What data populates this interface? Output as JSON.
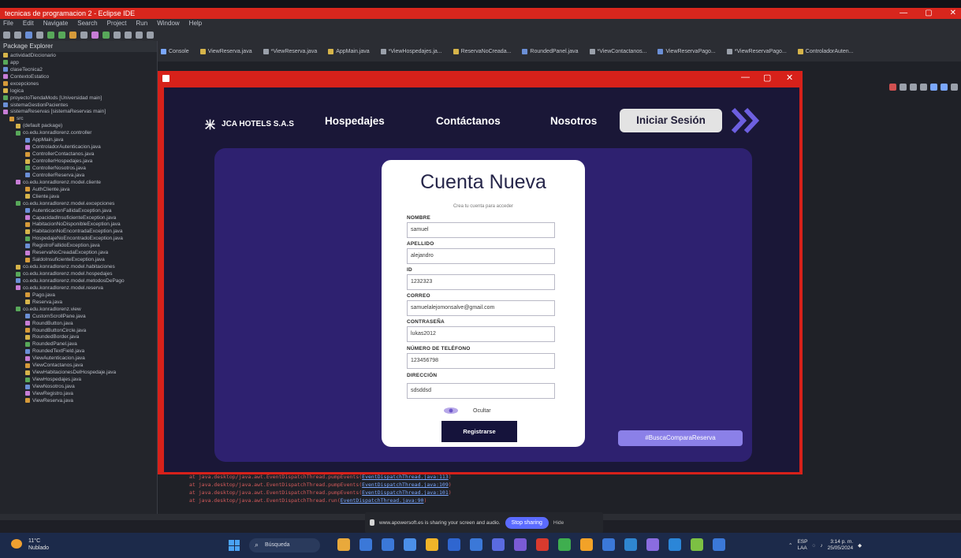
{
  "eclipse": {
    "title": "tecnicas de programacion 2 - Eclipse IDE",
    "window_controls": [
      "—",
      "▢",
      "✕"
    ],
    "menu": [
      "File",
      "Edit",
      "Navigate",
      "Search",
      "Project",
      "Run",
      "Window",
      "Help"
    ],
    "package_explorer_title": "Package Explorer",
    "tree": [
      "actividadDiccionario",
      "app",
      "claseTecnica2",
      "ContextoEstatico",
      "excepciones",
      "logica",
      "proyectoTiendaMods [Universidad main]",
      "sistemaGestionPacientes",
      "sistemaReservas [sistemaReservas main]",
      "src",
      "(default package)",
      "co.edu.konradlorenz.controller",
      "AppMain.java",
      "ControladorAutenticacion.java",
      "ControllerContactanos.java",
      "ControllerHospedajes.java",
      "ControllerNosotros.java",
      "ControllerReserva.java",
      "co.edu.konradlorenz.model.cliente",
      "AuthCliente.java",
      "Cliente.java",
      "co.edu.konradlorenz.model.excepciones",
      "AutenticacionFallidaException.java",
      "CapacidadInsuficienteException.java",
      "HabitacionNoDisponibleException.java",
      "HabitacionNoEncontradaException.java",
      "HospedajeNoEncontradoException.java",
      "RegistroFallidoException.java",
      "ReservaNoCreadaException.java",
      "SaldoInsuficienteException.java",
      "co.edu.konradlorenz.model.habitaciones",
      "co.edu.konradlorenz.model.hospedajes",
      "co.edu.konradlorenz.model.metodosDePago",
      "co.edu.konradlorenz.model.reserva",
      "Pago.java",
      "Reserva.java",
      "co.edu.konradlorenz.view",
      "CustomScrollPane.java",
      "RoundButton.java",
      "RoundButtonCircle.java",
      "RoundedBorder.java",
      "RoundedPanel.java",
      "RoundedTextField.java",
      "ViewAutenticacion.java",
      "ViewContactanos.java",
      "ViewHabitacionesDelHospedaje.java",
      "ViewHospedajes.java",
      "ViewNosotros.java",
      "ViewRegistro.java",
      "ViewReserva.java"
    ],
    "tabs": [
      "Console",
      "ViewReserva.java",
      "*ViewReserva.java",
      "AppMain.java",
      "*ViewHospedajes.ja...",
      "ReservaNoCreada...",
      "RoundedPanel.java",
      "*ViewContactanos...",
      "ViewReservaPago...",
      "*ViewReservaPago...",
      "ControladorAuten..."
    ],
    "console": [
      {
        "text": "at java.desktop/java.awt.EventDispatchThread.pumpEvents(",
        "link": "EventDispatchThread.java:113",
        "end": ")"
      },
      {
        "text": "at java.desktop/java.awt.EventDispatchThread.pumpEvents(",
        "link": "EventDispatchThread.java:109",
        "end": ")"
      },
      {
        "text": "at java.desktop/java.awt.EventDispatchThread.pumpEvents(",
        "link": "EventDispatchThread.java:101",
        "end": ")"
      },
      {
        "text": "at java.desktop/java.awt.EventDispatchThread.run(",
        "link": "EventDispatchThread.java:90",
        "end": ")"
      }
    ]
  },
  "app": {
    "window_controls": [
      "—",
      "▢",
      "✕"
    ],
    "brand": "JCA HOTELS S.A.S",
    "nav": {
      "hospedajes": "Hospedajes",
      "contactanos": "Contáctanos",
      "nosotros": "Nosotros",
      "login": "Iniciar Sesión"
    },
    "form": {
      "title": "Cuenta Nueva",
      "subtitle": "Crea tu cuenta para acceder",
      "fields": [
        {
          "label": "NOMBRE",
          "value": "samuel"
        },
        {
          "label": "APELLIDO",
          "value": "alejandro"
        },
        {
          "label": "ID",
          "value": "1232323"
        },
        {
          "label": "CORREO",
          "value": "samuelalejomonsalve@gmail.com"
        },
        {
          "label": "CONTRASEÑA",
          "value": "lukas2012"
        },
        {
          "label": "NÚMERO DE TELÉFONO",
          "value": "123456798"
        },
        {
          "label": "DIRECCIÓN",
          "value": "sdsddsd"
        }
      ],
      "hide_label": "Ocultar",
      "submit": "Registrarse"
    },
    "hashtag": "#BuscaComparaReserva"
  },
  "share_bar": {
    "text": "www.apowersoft.es is sharing your screen and audio.",
    "stop": "Stop sharing",
    "hide": "Hide"
  },
  "taskbar": {
    "weather_temp": "11°C",
    "weather_desc": "Nublado",
    "search": "Búsqueda",
    "lang": "ESP",
    "lang2": "LAA",
    "time": "3:14 p. m.",
    "date": "25/05/2024"
  }
}
